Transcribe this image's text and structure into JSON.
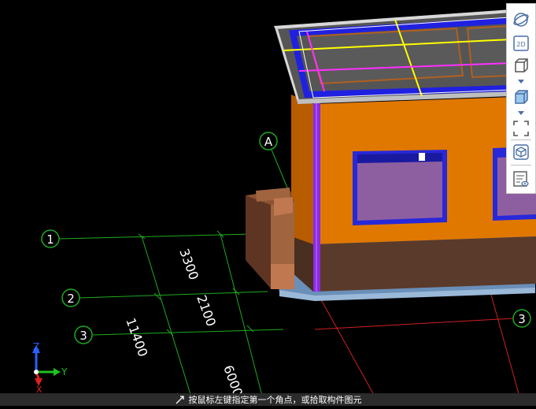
{
  "viewport": {
    "axis_bubbles": {
      "a": "A",
      "one": "1",
      "two": "2",
      "three_left": "3",
      "three_right": "3"
    },
    "dimensions": {
      "d1": "3300",
      "d2": "2100",
      "d3": "11400",
      "d4": "6000"
    },
    "gizmo": {
      "z": "Z",
      "y": "Y",
      "x": "X"
    }
  },
  "toolbar": {
    "items": [
      "orbit-icon",
      "view-2d-icon",
      "view-3d-box-icon",
      "view-3d-solid-icon",
      "zoom-extents-icon",
      "display-toggle-icon",
      "properties-view-icon"
    ],
    "label_2d": "2D"
  },
  "status": {
    "message": "按鼠标左键指定第一个角点，或拾取构件图元"
  },
  "colors": {
    "background": "#000000",
    "grid": "#1faa1f",
    "wall_orange": "#e07800",
    "wall_dark": "#b85c00",
    "base": "#5a3a2a",
    "window_frame": "#2828d8",
    "window_glass": "#8e5fa0",
    "roof_lines_yellow": "#ffff00",
    "roof_lines_magenta": "#ff30ff",
    "accent_blue": "#4a6fa5"
  }
}
